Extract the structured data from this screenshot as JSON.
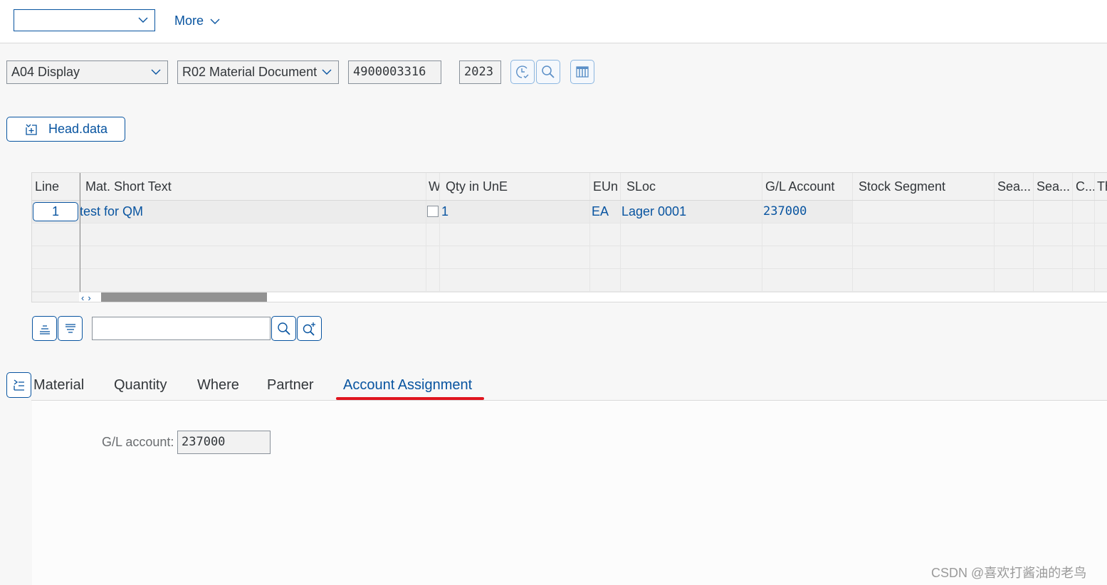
{
  "topbar": {
    "select_value": "",
    "more_label": "More"
  },
  "selection": {
    "action": "A04 Display",
    "reference": "R02 Material Document",
    "document_number": "4900003316",
    "year": "2023"
  },
  "toolbar_icons": [
    "history-icon",
    "search-icon",
    "table-settings-icon"
  ],
  "head_button": {
    "label": "Head.data",
    "icon": "expand-header-icon"
  },
  "table": {
    "columns": [
      "Line",
      "Mat. Short Text",
      "W",
      "Qty in UnE",
      "EUn",
      "SLoc",
      "G/L Account",
      "Stock Segment",
      "Sea...",
      "Sea...",
      "C...",
      "Th"
    ],
    "rows": [
      {
        "line": "1",
        "mat_short_text": "test for QM",
        "w_checked": false,
        "qty": "1",
        "eun": "EA",
        "sloc": "Lager 0001",
        "gl_account": "237000",
        "stock_segment": "",
        "sea1": "",
        "sea2": "",
        "c": "",
        "th": ""
      }
    ],
    "empty_rows": 3
  },
  "table_tools": {
    "search_value": "",
    "buttons": [
      "collapse-all-icon",
      "expand-all-icon",
      "find-icon",
      "find-next-icon"
    ]
  },
  "tabs": {
    "items": [
      "Material",
      "Quantity",
      "Where",
      "Partner",
      "Account Assignment"
    ],
    "active": "Account Assignment",
    "highlight_color": "#e0151f"
  },
  "account_assignment": {
    "gl_label": "G/L account:",
    "gl_value": "237000"
  },
  "watermark": "CSDN @喜欢打酱油的老鸟",
  "colors": {
    "accent": "#0854a0",
    "background": "#f7f7f7",
    "table_bg": "#f2f2f2"
  }
}
